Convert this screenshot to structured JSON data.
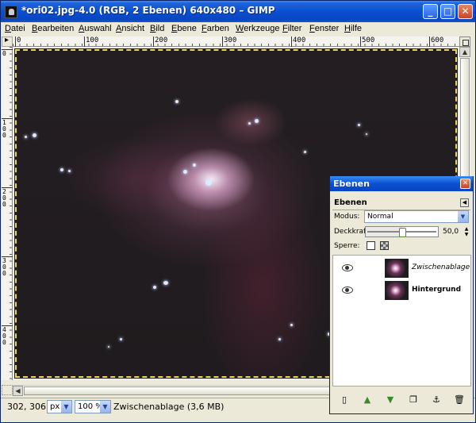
{
  "window": {
    "title": "*ori02.jpg-4.0 (RGB, 2 Ebenen) 640x480 – GIMP",
    "minimize": "_",
    "maximize": "□",
    "close": "✕"
  },
  "menu": [
    "Datei",
    "Bearbeiten",
    "Auswahl",
    "Ansicht",
    "Bild",
    "Ebene",
    "Farben",
    "Werkzeuge",
    "Filter",
    "Fenster",
    "Hilfe"
  ],
  "rulers": {
    "horizontal_labels": [
      "0",
      "100",
      "200",
      "300",
      "400",
      "500",
      "600"
    ],
    "vertical_labels": [
      "0",
      "100",
      "200",
      "300",
      "400"
    ]
  },
  "statusbar": {
    "coordinates": "302, 306",
    "unit": "px",
    "zoom": "100 %",
    "message": "Zwischenablage (3,6 MB)"
  },
  "layers_dock": {
    "title": "Ebenen",
    "tab": "Ebenen",
    "mode_label": "Modus:",
    "mode_value": "Normal",
    "opacity_label": "Deckkraft:",
    "opacity_value": "50,0",
    "opacity": 50,
    "lock_label": "Sperre:",
    "layers": [
      {
        "name": "Zwischenablage",
        "visible": true
      },
      {
        "name": "Hintergrund",
        "visible": true
      }
    ],
    "buttons": [
      "new-layer-icon",
      "raise-layer-icon",
      "lower-layer-icon",
      "duplicate-layer-icon",
      "anchor-layer-icon",
      "delete-layer-icon"
    ]
  },
  "colors": {
    "title_blue": "#0a4fd1",
    "selection_dash": "#e8d860"
  }
}
